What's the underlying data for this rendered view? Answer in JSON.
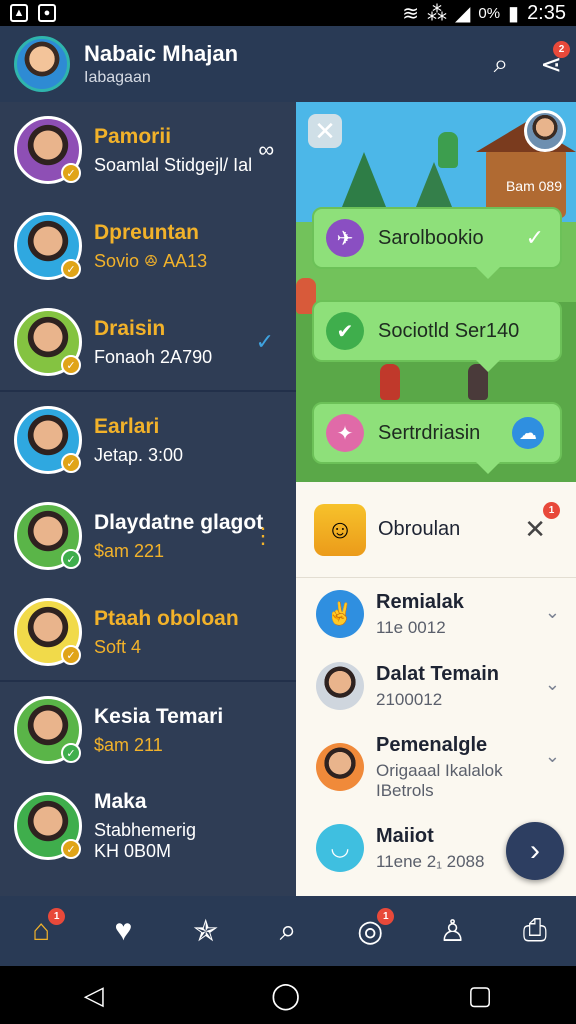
{
  "statusbar": {
    "time": "2:35",
    "battery": "0%",
    "icons": [
      "gallery-icon",
      "camera-icon",
      "wifi-icon",
      "vibrate-icon",
      "signal-icon",
      "battery-icon"
    ]
  },
  "header": {
    "title": "Nabaic Mhajan",
    "subtitle": "Iabagaan",
    "icons": [
      "search-icon",
      "share-icon"
    ],
    "share_badge": "2"
  },
  "contacts": [
    {
      "name": "Pamorii",
      "sub": "Soamlal Stidgejl/ Ial",
      "name_color": "#f2b22a",
      "sub_color": "#ffffff",
      "status_color": "#e0a418",
      "status_icon": "check-icon",
      "bg": "#8e4fb5",
      "extra": "∞"
    },
    {
      "name": "Dpreuntan",
      "sub": "Sovio ꔮ AA13",
      "name_color": "#f2b22a",
      "sub_color": "#f2b22a",
      "status_color": "#e0a418",
      "status_icon": "check-icon",
      "bg": "#2fa8e0",
      "extra": ""
    },
    {
      "name": "Draisin",
      "sub": "Fonaoh 2A790",
      "name_color": "#f2b22a",
      "sub_color": "#ffffff",
      "status_color": "#e0a418",
      "status_icon": "check-icon",
      "bg": "#84c341",
      "extra": "✓"
    },
    {
      "name": "Earlari",
      "sub": "Jetap. 3:00",
      "name_color": "#f2b22a",
      "sub_color": "#ffffff",
      "status_color": "#e0a418",
      "status_icon": "check-icon",
      "bg": "#2fa8e0",
      "extra": ""
    },
    {
      "name": "Dlaydatne glagot",
      "sub": "$am 221",
      "name_color": "#ffffff",
      "sub_color": "#f2b22a",
      "status_color": "#3fae4c",
      "status_icon": "check-icon",
      "bg": "#5ab548",
      "extra": "⋮"
    },
    {
      "name": "Ptaah oboloan",
      "sub": "Soft 4",
      "name_color": "#f2b22a",
      "sub_color": "#f2b22a",
      "status_color": "#e0a418",
      "status_icon": "check-icon",
      "bg": "#f1da4a",
      "extra": ""
    },
    {
      "name": "Kesia Temari",
      "sub": "$am 211",
      "name_color": "#ffffff",
      "sub_color": "#f2b22a",
      "status_color": "#3fae4c",
      "status_icon": "check-icon",
      "bg": "#5ab548",
      "extra": ""
    },
    {
      "name": "Maka",
      "sub": "Stabhemerig",
      "sub2": "KH 0B0M",
      "name_color": "#ffffff",
      "sub_color": "#ffffff",
      "status_color": "#e0a418",
      "status_icon": "check-icon",
      "bg": "#3fae4c",
      "extra": ""
    }
  ],
  "game": {
    "close_icon": "close-icon",
    "label": "Bam 089",
    "bubbles": [
      {
        "label": "Sarolbookio",
        "icon": "plane-icon",
        "icon_color": "#8a4fc2",
        "trail": "✓"
      },
      {
        "label": "Sociotld Ser140",
        "icon": "check-icon",
        "icon_color": "#3fae4c",
        "trail": ""
      },
      {
        "label": "Sertrdriasin",
        "icon": "sparkle-icon",
        "icon_color": "#e06aa8",
        "trail": "☁"
      }
    ]
  },
  "notification": {
    "label": "Obroulan",
    "badge": "1",
    "icon": "app-face-icon"
  },
  "list": [
    {
      "name": "Remialak",
      "sub": "11e 0012",
      "avatar_bg": "#2f8fe0",
      "icon": "thumbs-up-icon"
    },
    {
      "name": "Dalat Temain",
      "sub": "2100012",
      "avatar_bg": "#cfd6de",
      "icon": "person-icon"
    },
    {
      "name": "Pemenalgle",
      "sub": "Origaaal Ikalalok",
      "sub2": "IBetrols",
      "avatar_bg": "#f08a3a",
      "icon": "person-icon"
    },
    {
      "name": "Maiiot",
      "sub": "11ene 2₁ 2088",
      "avatar_bg": "#3fbfe0",
      "icon": "bowl-icon"
    }
  ],
  "bottom_nav": [
    {
      "icon": "home-icon",
      "glyph": "⌂",
      "badge": "1",
      "active": true
    },
    {
      "icon": "heart-location-icon",
      "glyph": "♥",
      "badge": "",
      "active": false
    },
    {
      "icon": "star-hands-icon",
      "glyph": "✯",
      "badge": "",
      "active": false
    },
    {
      "icon": "search-icon",
      "glyph": "⌕",
      "badge": "",
      "active": false
    },
    {
      "icon": "camera-icon",
      "glyph": "◎",
      "badge": "1",
      "active": false
    },
    {
      "icon": "profile-icon",
      "glyph": "♙",
      "badge": "",
      "active": false
    },
    {
      "icon": "camera-settings-icon",
      "glyph": "⎙",
      "badge": "",
      "active": false
    }
  ],
  "system_nav": {
    "back": "◁",
    "home": "◯",
    "recents": "▢"
  }
}
